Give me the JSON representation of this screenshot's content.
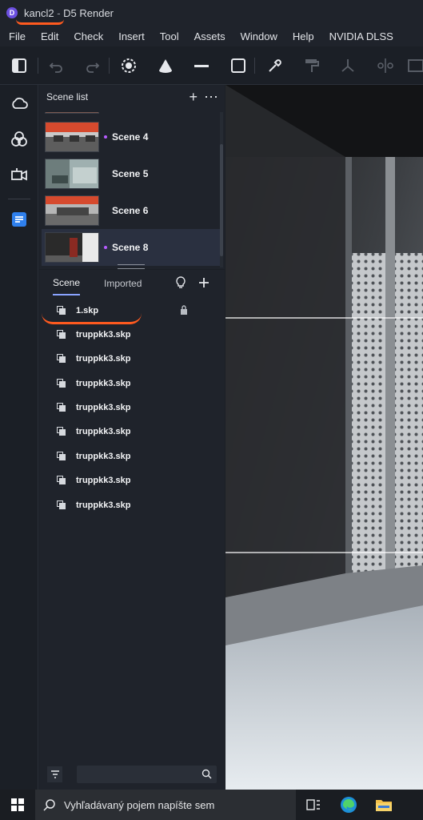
{
  "window": {
    "doc_name": "kancl2",
    "separator": " - ",
    "app_name": "D5 Render",
    "logo_letter": "D"
  },
  "menu": [
    "File",
    "Edit",
    "Check",
    "Insert",
    "Tool",
    "Assets",
    "Window",
    "Help",
    "NVIDIA DLSS"
  ],
  "scene_list": {
    "title": "Scene list",
    "items": [
      {
        "label": "Scene 4",
        "marked": true,
        "selected": false
      },
      {
        "label": "Scene 5",
        "marked": false,
        "selected": false
      },
      {
        "label": "Scene 6",
        "marked": false,
        "selected": false
      },
      {
        "label": "Scene 8",
        "marked": true,
        "selected": true
      }
    ]
  },
  "layers": {
    "tabs": [
      "Scene",
      "Imported"
    ],
    "active_tab": "Scene",
    "rows": [
      "1.skp",
      "truppkk3.skp",
      "truppkk3.skp",
      "truppkk3.skp",
      "truppkk3.skp",
      "truppkk3.skp",
      "truppkk3.skp",
      "truppkk3.skp",
      "truppkk3.skp"
    ],
    "search_value": ""
  },
  "taskbar": {
    "search_placeholder": "Vyhľadávaný pojem napíšte sem"
  },
  "colors": {
    "accent": "#8aa3ff",
    "annotation": "#ff5a1f",
    "scene_marker": "#b65cff",
    "brand": "#6b4fe0"
  }
}
